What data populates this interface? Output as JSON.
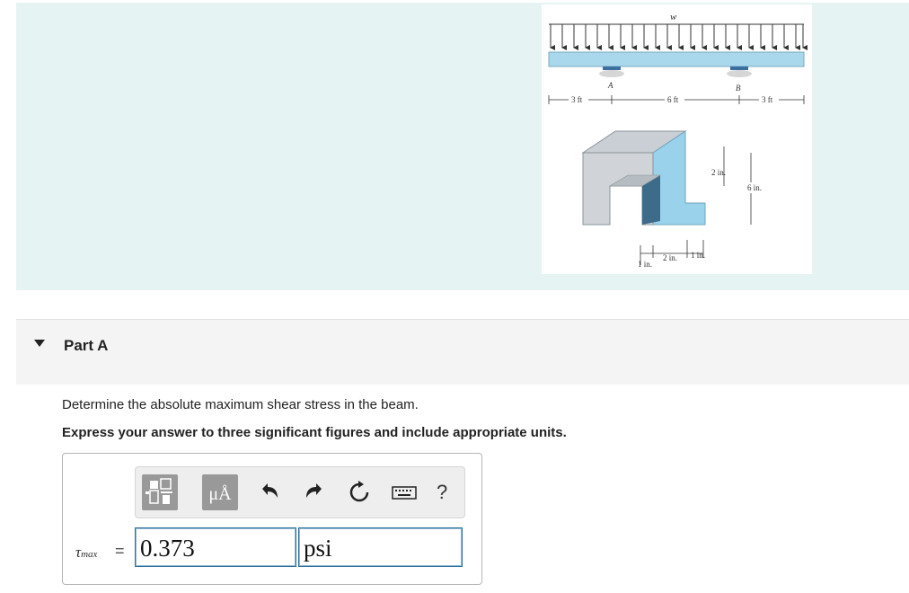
{
  "figure": {
    "load_label": "w",
    "support_a": "A",
    "support_b": "B",
    "dim_left": "3 ft",
    "dim_mid": "6 ft",
    "dim_right": "3 ft",
    "dim_top_height": "2 in.",
    "dim_total_height": "6 in.",
    "dim_bottom_left": "1 in.",
    "dim_bottom_mid": "2 in.",
    "dim_bottom_right": "1 in."
  },
  "part": {
    "title": "Part A"
  },
  "question": {
    "text": "Determine the absolute maximum shear stress in the beam.",
    "instruction": "Express your answer to three significant figures and include appropriate units."
  },
  "toolbar": {
    "units_label": "μÅ",
    "help_label": "?"
  },
  "answer": {
    "symbol": "τ",
    "subscript": "max",
    "equals": "=",
    "value": "0.373",
    "unit": "psi"
  },
  "colors": {
    "panel_bg": "#e6f3f3",
    "beam": "#a9d8ec",
    "input_border": "#2f6f9a",
    "tool_button": "#999999"
  }
}
